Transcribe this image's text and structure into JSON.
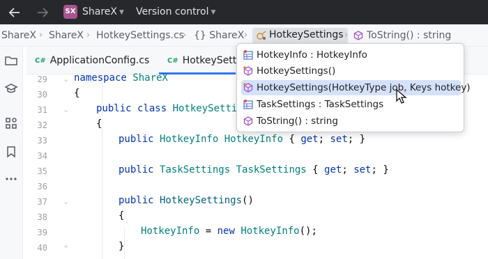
{
  "titlebar": {
    "project_badge": "SX",
    "project_name": "ShareX",
    "vcs_label": "Version control"
  },
  "breadcrumb": {
    "items": [
      "ShareX",
      "ShareX",
      "HotkeySettings.cs",
      "{} ShareX",
      "HotkeySettings",
      "ToString() : string"
    ]
  },
  "tabs": [
    {
      "label": "ApplicationConfig.cs",
      "lang": "C#"
    },
    {
      "label": "HotkeySetti",
      "lang": "C#"
    }
  ],
  "code": {
    "line_numbers": [
      "29",
      "30",
      "31",
      "32",
      "33",
      "34",
      "35",
      "36",
      "37",
      "38",
      "39",
      "40"
    ],
    "lines": {
      "l29_kw": "namespace",
      "l29_name": " ShareX",
      "l30": "{",
      "l31_kw": "public class",
      "l31_name": " HotkeySettin",
      "l32": "{",
      "l33_kw": "public",
      "l33_type": " HotkeyInfo",
      "l33_name": " HotkeyInfo",
      "l33_rest_a": " { ",
      "l33_get": "get",
      "l33_semi1": "; ",
      "l33_set": "set",
      "l33_rest_b": "; }",
      "l35_kw": "public",
      "l35_type": " TaskSettings",
      "l35_name": " TaskSettings",
      "l35_rest_a": " { ",
      "l35_get": "get",
      "l35_semi1": "; ",
      "l35_set": "set",
      "l35_rest_b": "; }",
      "l37_kw": "public",
      "l37_name": " HotkeySettings",
      "l37_rest": "()",
      "l38": "{",
      "l39_name": "HotkeyInfo",
      "l39_eq": " = ",
      "l39_new": "new",
      "l39_type": " HotkeyInfo",
      "l39_rest": "();",
      "l40": "}"
    }
  },
  "popup": {
    "items": [
      {
        "label": "HotkeyInfo : HotkeyInfo",
        "icon": "property-icon"
      },
      {
        "label": "HotkeySettings()",
        "icon": "method-icon"
      },
      {
        "label": "HotkeySettings(HotkeyType job, Keys hotkey)",
        "icon": "method-icon",
        "selected": true
      },
      {
        "label": "TaskSettings : TaskSettings",
        "icon": "property-icon"
      },
      {
        "label": "ToString() : string",
        "icon": "method-icon"
      }
    ]
  },
  "colors": {
    "keyword": "#0033b3",
    "type": "#008080",
    "method": "#00627a",
    "selection": "#d5e1fb",
    "accent": "#3574f0",
    "badge": "#a8558f"
  }
}
